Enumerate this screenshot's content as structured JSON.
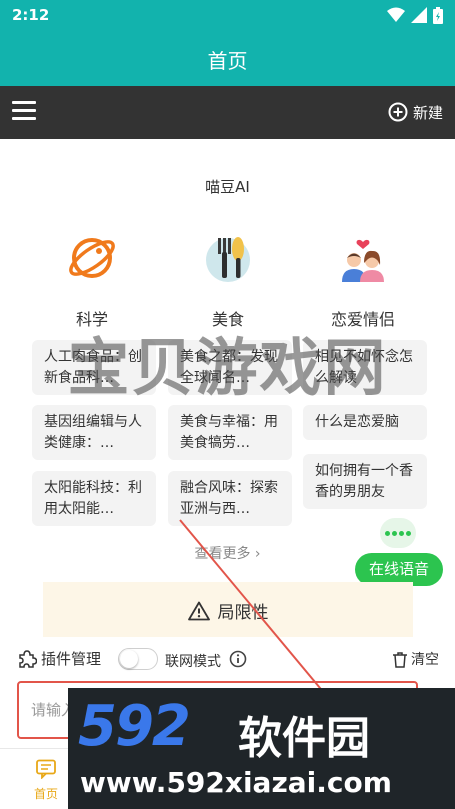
{
  "status_bar": {
    "time": "2:12"
  },
  "header": {
    "title": "首页"
  },
  "toolbar": {
    "new_label": "新建"
  },
  "app_name": "喵豆AI",
  "categories": [
    {
      "label": "科学",
      "icon": "planet-icon"
    },
    {
      "label": "美食",
      "icon": "fork-knife-icon"
    },
    {
      "label": "恋爱情侣",
      "icon": "couple-icon"
    }
  ],
  "cards": {
    "science": [
      "人工肉食品：创新食品科…",
      "基因组编辑与人类健康：…",
      "太阳能科技：利用太阳能…"
    ],
    "food": [
      "美食之都：发现全球闻名…",
      "美食与幸福：用美食犒劳…",
      "融合风味：探索亚洲与西…"
    ],
    "love": [
      "相见不如怀念怎么解读",
      "什么是恋爱脑",
      "如何拥有一个香香的男朋友"
    ]
  },
  "see_more": "查看更多",
  "voice_button": "在线语音",
  "limitations": "局限性",
  "plugin_manager": "插件管理",
  "network_mode": "联网模式",
  "clear": "清空",
  "input": {
    "placeholder": "请输入"
  },
  "bottom_nav": {
    "home": "首页"
  },
  "watermark": {
    "center_text": "宝贝游戏网",
    "logo_number": "592",
    "logo_text": "软件园",
    "url": "www.592xiazai.com"
  },
  "colors": {
    "primary": "#12b3ad",
    "toolbar": "#333333",
    "voice_green": "#2cc44f",
    "limit_bg": "#fdf6e7",
    "input_border": "#e2554a",
    "nav_active": "#e8a818"
  }
}
